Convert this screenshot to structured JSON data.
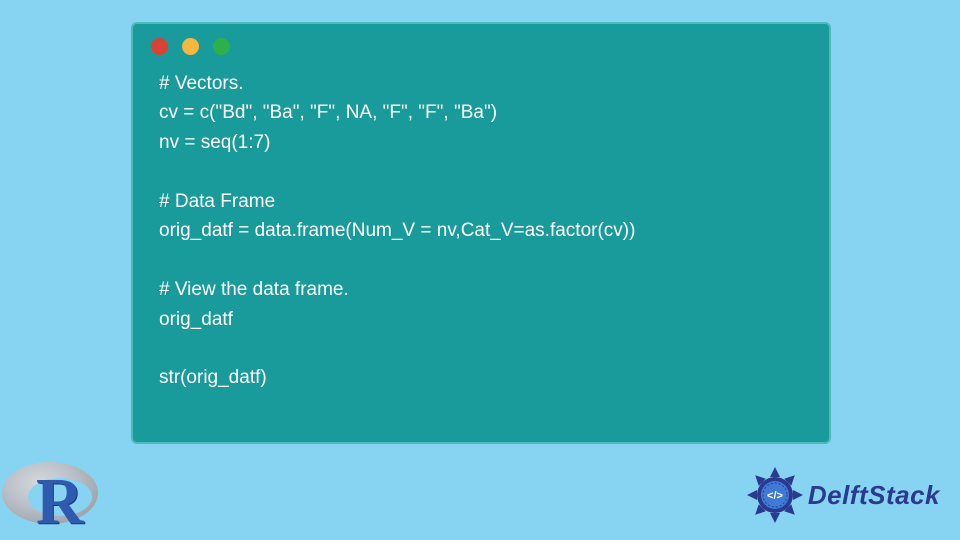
{
  "window": {
    "controls": {
      "red": "close",
      "yellow": "minimize",
      "green": "maximize"
    }
  },
  "code": {
    "lines": [
      "# Vectors.",
      "cv = c(\"Bd\", \"Ba\", \"F\", NA, \"F\", \"F\", \"Ba\")",
      "nv = seq(1:7)",
      "",
      "# Data Frame",
      "orig_datf = data.frame(Num_V = nv,Cat_V=as.factor(cv))",
      "",
      "# View the data frame.",
      "orig_datf",
      "",
      "str(orig_datf)"
    ]
  },
  "logos": {
    "r_letter": "R",
    "delft_label": "DelftStack"
  },
  "colors": {
    "background": "#87d4f2",
    "code_bg": "#1a9b9b",
    "code_text": "#ffffff",
    "brand_blue": "#2b3a8f"
  }
}
